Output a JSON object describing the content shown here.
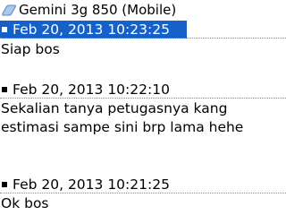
{
  "header": {
    "title": "Gemini 3g 850 (Mobile)",
    "icon": "chat-bubble-icon"
  },
  "messages": [
    {
      "timestamp": "Feb 20, 2013 10:23:25",
      "text": [
        "Siap bos"
      ],
      "selected": true
    },
    {
      "timestamp": "Feb 20, 2013 10:22:10",
      "text": [
        "Sekalian tanya petugasnya kang",
        "estimasi sampe sini brp lama hehe"
      ],
      "selected": false
    },
    {
      "timestamp": "Feb 20, 2013 10:21:25",
      "text": [
        "Ok bos"
      ],
      "selected": false
    }
  ],
  "colors": {
    "selection": "#1560c9",
    "divider": "#8c8c8c"
  }
}
